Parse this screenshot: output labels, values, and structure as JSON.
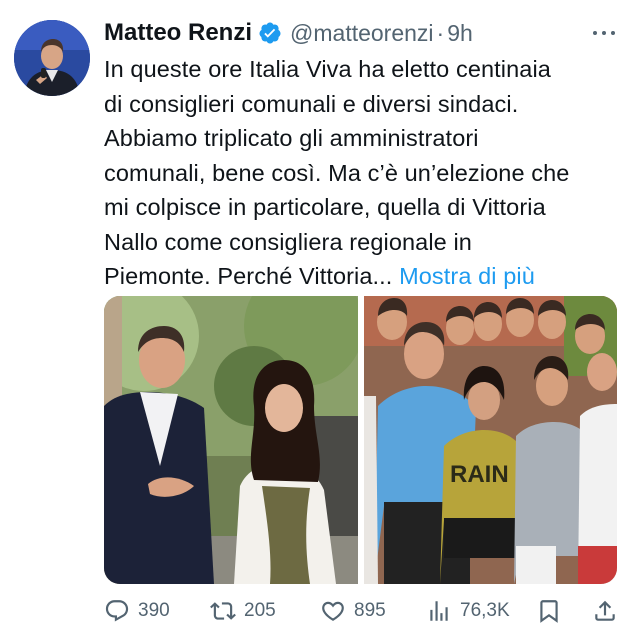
{
  "author": {
    "name": "Matteo Renzi",
    "handle": "@matteorenzi",
    "separator": "·",
    "time": "9h",
    "verified": true
  },
  "tweet": {
    "lines": [
      "In queste ore Italia Viva ha eletto centinaia",
      "di consiglieri comunali e diversi sindaci.",
      "Abbiamo triplicato gli amministratori",
      "comunali, bene così. Ma c’è un’elezione che",
      "mi colpisce in particolare, quella di Vittoria",
      "Nallo come consigliera regionale in",
      "Piemonte. Perché Vittoria..."
    ],
    "show_more": "Mostra di più"
  },
  "media": {
    "photo_count": 2,
    "right_photo_shirt_text": "RAIN"
  },
  "actions": {
    "replies": "390",
    "retweets": "205",
    "likes": "895",
    "views": "76,3K"
  },
  "icons": {
    "reply": "reply-icon",
    "retweet": "retweet-icon",
    "like": "heart-icon",
    "views": "views-icon",
    "bookmark": "bookmark-icon",
    "share": "share-icon",
    "more": "more-icon",
    "verified": "verified-badge-icon"
  },
  "colors": {
    "text": "#0f1419",
    "secondary": "#536471",
    "link": "#1d9bf0",
    "verified": "#1d9bf0"
  }
}
